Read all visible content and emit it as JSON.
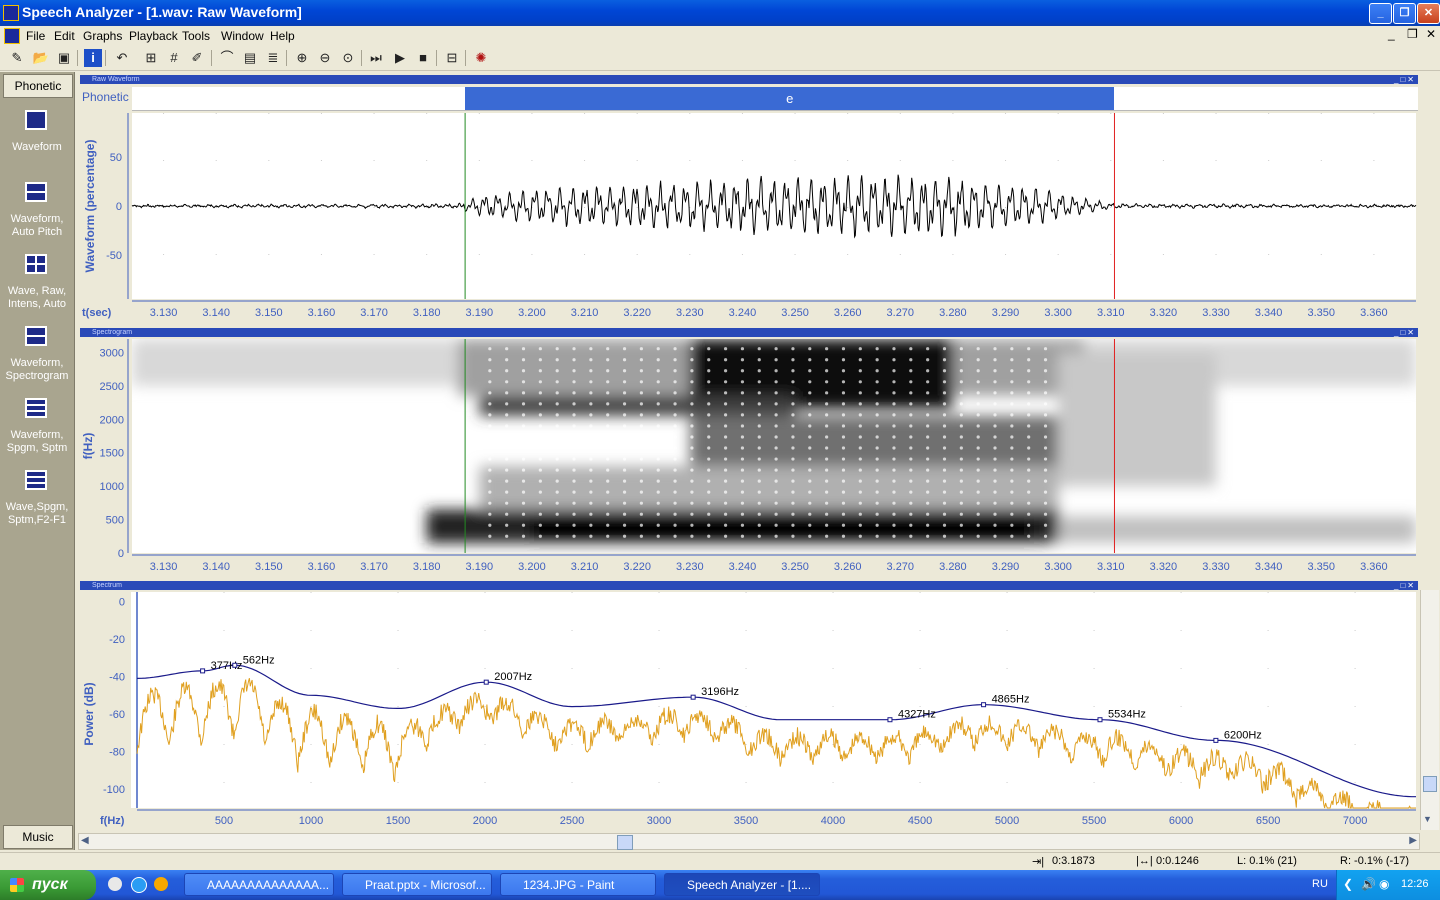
{
  "window": {
    "title": "Speech Analyzer - [1.wav: Raw Waveform]"
  },
  "menu": [
    "File",
    "Edit",
    "Graphs",
    "Playback",
    "Tools",
    "Window",
    "Help"
  ],
  "toolbar": [
    {
      "name": "wand-icon",
      "glyph": "✎"
    },
    {
      "name": "open-icon",
      "glyph": "📂"
    },
    {
      "name": "save-icon",
      "glyph": "▣"
    },
    {
      "name": "info-icon",
      "glyph": "i"
    },
    {
      "name": "undo-icon",
      "glyph": "↶"
    },
    {
      "name": "graph-params-icon",
      "glyph": "⊞"
    },
    {
      "name": "grid-icon",
      "glyph": "#"
    },
    {
      "name": "edit-icon",
      "glyph": "✐"
    },
    {
      "name": "chart-icon",
      "glyph": "⌒"
    },
    {
      "name": "layout-icon",
      "glyph": "▤"
    },
    {
      "name": "layers-icon",
      "glyph": "≣"
    },
    {
      "name": "zoom-in-icon",
      "glyph": "⊕"
    },
    {
      "name": "zoom-out-icon",
      "glyph": "⊖"
    },
    {
      "name": "zoom-fit-icon",
      "glyph": "⊙"
    },
    {
      "name": "play-segment-icon",
      "glyph": "⏭"
    },
    {
      "name": "play-icon",
      "glyph": "▶"
    },
    {
      "name": "stop-icon",
      "glyph": "■"
    },
    {
      "name": "record-icon",
      "glyph": "⊟"
    },
    {
      "name": "plugin-icon",
      "glyph": "✺"
    }
  ],
  "left_pane": {
    "top_tab": "Phonetic",
    "bottom_tab": "Music",
    "layouts": [
      "Waveform",
      "Waveform, Auto Pitch",
      "Wave, Raw, Intens, Auto",
      "Waveform, Spectrogram",
      "Waveform, Spgm, Sptm",
      "Wave,Spgm, Sptm,F2-F1"
    ]
  },
  "panels": {
    "waveform": {
      "title": "Raw Waveform",
      "annotation_label": "Phonetic",
      "segment": "e",
      "ylabel": "Waveform (percentage)",
      "xlabel": "t(sec)"
    },
    "spectrogram": {
      "title": "Spectrogram",
      "ylabel": "f(Hz)"
    },
    "spectrum": {
      "title": "Spectrum",
      "ylabel": "Power (dB)",
      "xlabel": "f(Hz)"
    }
  },
  "chart_data": [
    {
      "type": "line",
      "title": "",
      "ylabel": "Waveform (percentage)",
      "xlabel": "t(sec)",
      "xlim": [
        3.124,
        3.368
      ],
      "ylim": [
        -95,
        95
      ],
      "yticks": [
        50,
        0,
        -50
      ],
      "xticks": [
        3.13,
        3.14,
        3.15,
        3.16,
        3.17,
        3.18,
        3.19,
        3.2,
        3.21,
        3.22,
        3.23,
        3.24,
        3.25,
        3.26,
        3.27,
        3.28,
        3.29,
        3.3,
        3.31,
        3.32,
        3.33,
        3.34,
        3.35,
        3.36
      ],
      "xtick_labels": [
        "3.130",
        "3.140",
        "3.150",
        "3.160",
        "3.170",
        "3.180",
        "3.190",
        "3.200",
        "3.210",
        "3.220",
        "3.230",
        "3.240",
        "3.250",
        "3.260",
        "3.270",
        "3.280",
        "3.290",
        "3.300",
        "3.310",
        "3.320",
        "3.330",
        "3.340",
        "3.350",
        "3.360"
      ],
      "segment_start": 3.1873,
      "segment_end": 3.3107,
      "envelope": {
        "t": [
          3.124,
          3.186,
          3.19,
          3.2,
          3.22,
          3.24,
          3.26,
          3.28,
          3.295,
          3.305,
          3.311,
          3.368
        ],
        "amp": [
          1,
          2,
          10,
          18,
          22,
          28,
          30,
          30,
          20,
          8,
          2,
          1
        ]
      }
    },
    {
      "type": "heatmap",
      "ylabel": "f(Hz)",
      "xlim": [
        3.124,
        3.368
      ],
      "ylim": [
        0,
        3200
      ],
      "yticks": [
        3000,
        2500,
        2000,
        1500,
        1000,
        500,
        0
      ],
      "xtick_labels": [
        "3.130",
        "3.140",
        "3.150",
        "3.160",
        "3.170",
        "3.180",
        "3.190",
        "3.200",
        "3.210",
        "3.220",
        "3.230",
        "3.240",
        "3.250",
        "3.260",
        "3.270",
        "3.280",
        "3.290",
        "3.300",
        "3.310",
        "3.320",
        "3.330",
        "3.340",
        "3.350",
        "3.360"
      ]
    },
    {
      "type": "line",
      "ylabel": "Power (dB)",
      "xlabel": "f(Hz)",
      "xlim": [
        0,
        7350
      ],
      "ylim": [
        -110,
        5
      ],
      "yticks": [
        0,
        -20,
        -40,
        -60,
        -80,
        -100
      ],
      "xticks": [
        500,
        1000,
        1500,
        2000,
        2500,
        3000,
        3500,
        4000,
        4500,
        5000,
        5500,
        6000,
        6500,
        7000
      ],
      "envelope": {
        "name": "",
        "x": [
          0,
          377,
          562,
          1000,
          1500,
          2007,
          2500,
          3196,
          3700,
          4327,
          4865,
          5534,
          6200,
          7350
        ],
        "y": [
          -41,
          -37,
          -34,
          -50,
          -57,
          -43,
          -56,
          -51,
          -63,
          -63,
          -55,
          -63,
          -74,
          -104
        ]
      },
      "peaks": [
        {
          "f": 377,
          "db": -37,
          "label": "377Hz"
        },
        {
          "f": 562,
          "db": -34,
          "label": "562Hz"
        },
        {
          "f": 2007,
          "db": -43,
          "label": "2007Hz"
        },
        {
          "f": 3196,
          "db": -51,
          "label": "3196Hz"
        },
        {
          "f": 4327,
          "db": -63,
          "label": "4327Hz"
        },
        {
          "f": 4865,
          "db": -55,
          "label": "4865Hz"
        },
        {
          "f": 5534,
          "db": -63,
          "label": "5534Hz"
        },
        {
          "f": 6200,
          "db": -74,
          "label": "6200Hz"
        }
      ]
    }
  ],
  "status": {
    "position": "0:3.1873",
    "length": "0:0.1246",
    "left": "L: 0.1% (21)",
    "right": "R: -0.1% (-17)"
  },
  "taskbar": {
    "start": "пуск",
    "tasks": [
      "AAAAAAAAAAAAAA...",
      "Praat.pptx - Microsof...",
      "1234.JPG - Paint",
      "Speech Analyzer - [1...."
    ],
    "lang": "RU",
    "clock": "12:26"
  },
  "colors": {
    "spectrum_line": "#e0a020",
    "envelope": "#1a1a8a",
    "cursor_start": "#228b22",
    "cursor_end": "#e02020",
    "segment_bar": "#3a6ad4"
  }
}
